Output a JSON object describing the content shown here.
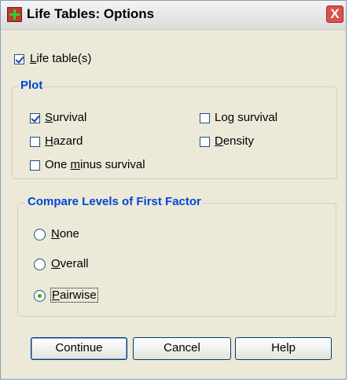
{
  "dialog": {
    "title": "Life Tables: Options",
    "close_label": "X"
  },
  "life_tables": {
    "label_prefix": "",
    "label_mnemonic": "L",
    "label_rest": "ife table(s)",
    "checked": true
  },
  "plot": {
    "legend": "Plot",
    "options": [
      {
        "label_prefix": "",
        "mnemonic": "S",
        "rest": "urvival",
        "checked": true
      },
      {
        "label_prefix": "Lo",
        "mnemonic": "g",
        "rest": " survival",
        "checked": false
      },
      {
        "label_prefix": "",
        "mnemonic": "H",
        "rest": "azard",
        "checked": false
      },
      {
        "label_prefix": "",
        "mnemonic": "D",
        "rest": "ensity",
        "checked": false
      },
      {
        "label_prefix": "One ",
        "mnemonic": "m",
        "rest": "inus survival",
        "checked": false
      }
    ]
  },
  "compare": {
    "legend": "Compare Levels of First Factor",
    "options": [
      {
        "label_prefix": "",
        "mnemonic": "N",
        "rest": "one",
        "selected": false
      },
      {
        "label_prefix": "",
        "mnemonic": "O",
        "rest": "verall",
        "selected": false
      },
      {
        "label_prefix": "",
        "mnemonic": "P",
        "rest": "airwise",
        "selected": true
      }
    ]
  },
  "buttons": {
    "continue": "Continue",
    "cancel": "Cancel",
    "help": "Help"
  }
}
